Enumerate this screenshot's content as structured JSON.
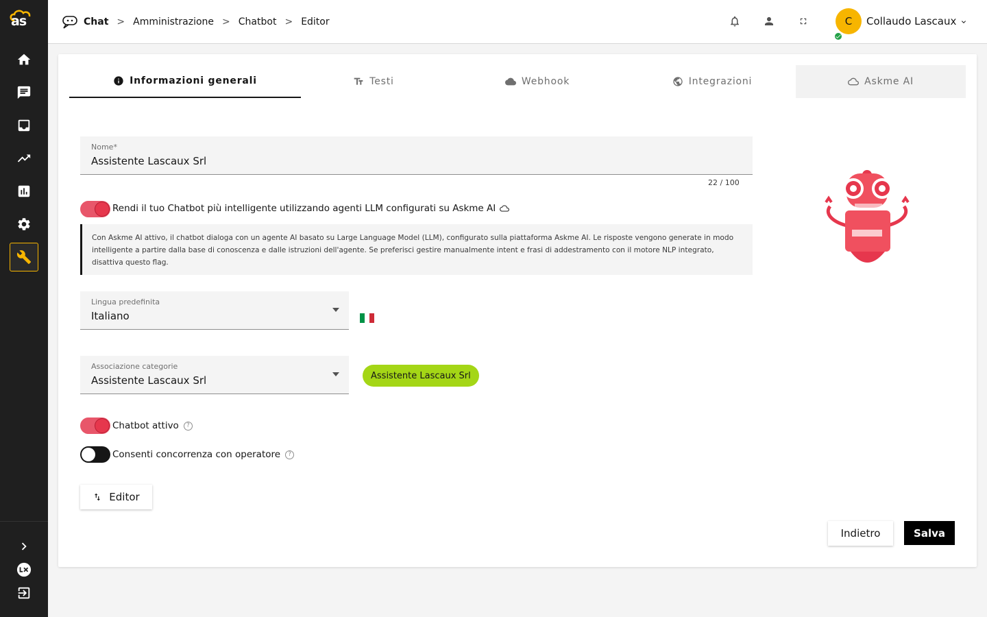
{
  "app": {
    "logo_text": "as"
  },
  "sidebar": {
    "items": [
      {
        "icon": "home-icon"
      },
      {
        "icon": "chat-icon"
      },
      {
        "icon": "inbox-icon"
      },
      {
        "icon": "trending-icon"
      },
      {
        "icon": "bar-chart-icon"
      },
      {
        "icon": "gear-icon"
      },
      {
        "icon": "wrench-icon",
        "active": true
      }
    ],
    "bottom": [
      {
        "icon": "chevron-right-icon"
      },
      {
        "icon": "lx-icon"
      },
      {
        "icon": "logout-icon"
      }
    ]
  },
  "breadcrumb": {
    "items": [
      "Chat",
      "Amministrazione",
      "Chatbot",
      "Editor"
    ],
    "separator": ">"
  },
  "header": {
    "user_initial": "C",
    "user_name": "Collaudo Lascaux"
  },
  "tabs": [
    {
      "label": "Informazioni generali",
      "icon": "info-icon",
      "active": true
    },
    {
      "label": "Testi",
      "icon": "text-icon"
    },
    {
      "label": "Webhook",
      "icon": "cloud-icon"
    },
    {
      "label": "Integrazioni",
      "icon": "globe-icon"
    },
    {
      "label": "Askme AI",
      "icon": "ai-cloud-icon"
    }
  ],
  "form": {
    "name": {
      "label": "Nome*",
      "value": "Assistente Lascaux Srl",
      "counter": "22 / 100"
    },
    "llm_toggle": {
      "label": "Rendi il tuo Chatbot più intelligente utilizzando agenti LLM configurati su Askme AI",
      "on": true
    },
    "llm_note": "Con Askme AI attivo, il chatbot dialoga con un agente AI basato su Large Language Model (LLM), configurato sulla piattaforma Askme AI. Le risposte vengono generate in modo intelligente a partire dalla base di conoscenza e dalle istruzioni dell'agente. Se preferisci gestire manualmente intent e frasi di addestramento con il motore NLP integrato, disattiva questo flag.",
    "language": {
      "label": "Lingua predefinita",
      "value": "Italiano"
    },
    "category": {
      "label": "Associazione categorie",
      "value": "Assistente Lascaux Srl",
      "chip": "Assistente Lascaux Srl"
    },
    "active_toggle": {
      "label": "Chatbot attivo",
      "on": true
    },
    "concurrency_toggle": {
      "label": "Consenti concorrenza con operatore",
      "on": false
    },
    "editor_button": "Editor"
  },
  "actions": {
    "back": "Indietro",
    "save": "Salva"
  },
  "colors": {
    "accent": "#f7b500",
    "toggle_on": "#e6374d",
    "chip": "#a4d616",
    "sidebar": "#1f1f1f"
  }
}
